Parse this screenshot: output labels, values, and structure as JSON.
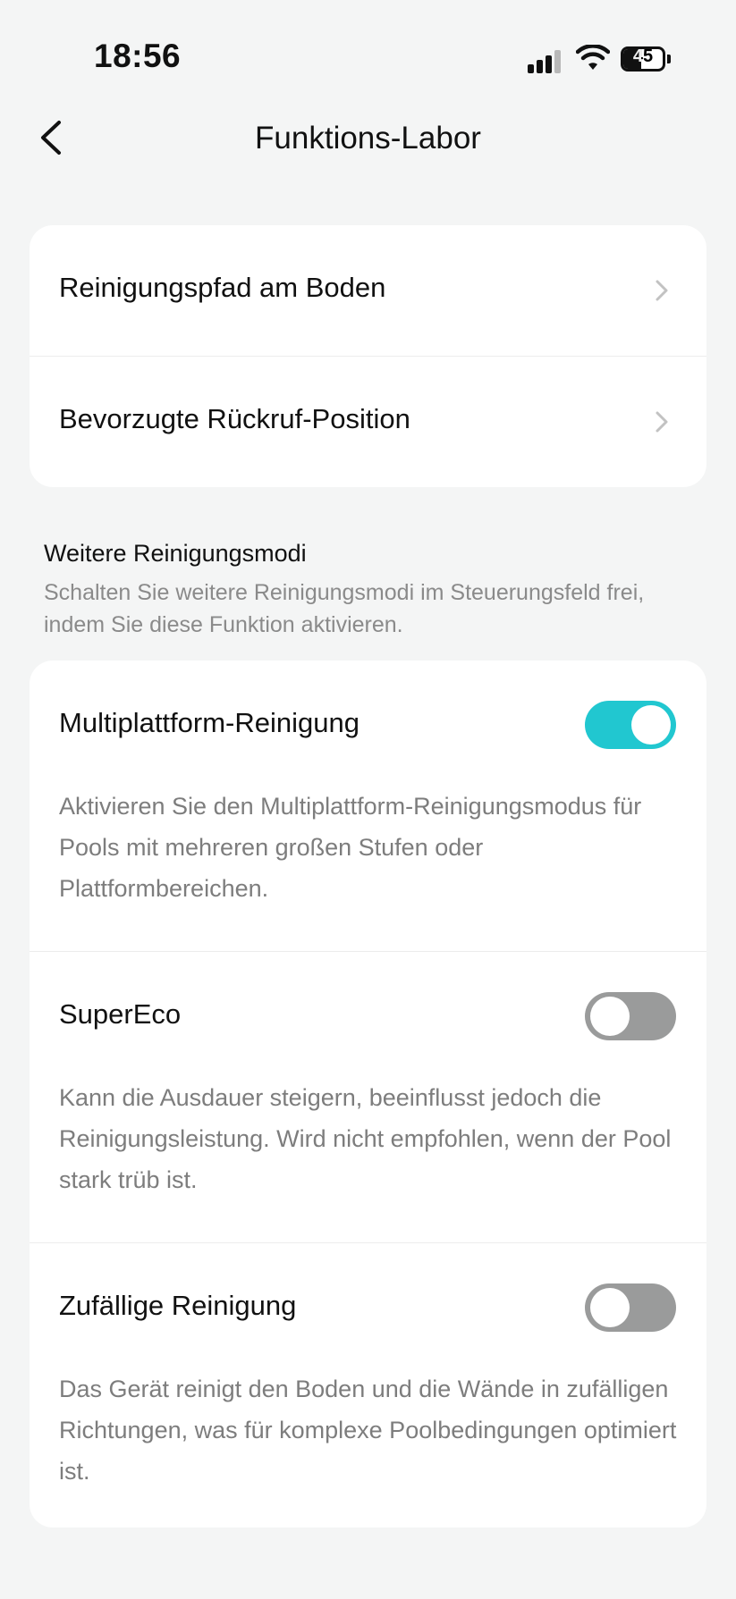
{
  "status_bar": {
    "time": "18:56",
    "battery_level": "45",
    "icons": [
      "signal-icon",
      "wifi-icon",
      "battery-icon"
    ]
  },
  "header": {
    "title": "Funktions-Labor",
    "back_icon": "chevron-left-icon"
  },
  "menu": {
    "items": [
      {
        "label": "Reinigungspfad am Boden",
        "icon": "chevron-right-icon"
      },
      {
        "label": "Bevorzugte Rückruf-Position",
        "icon": "chevron-right-icon"
      }
    ]
  },
  "modes_section": {
    "heading": "Weitere Reinigungsmodi",
    "description": "Schalten Sie weitere Reinigungsmodi im Steuerungsfeld frei, indem Sie diese Funktion aktivieren.",
    "toggles": [
      {
        "label": "Multiplattform-Reinigung",
        "enabled": true,
        "description": "Aktivieren Sie den Multiplattform-Reinigungsmodus für Pools mit mehreren großen Stufen oder Plattformbereichen."
      },
      {
        "label": "SuperEco",
        "enabled": false,
        "description": "Kann die Ausdauer steigern, beeinflusst jedoch die Reinigungsleistung. Wird nicht empfohlen, wenn der Pool stark trüb ist."
      },
      {
        "label": "Zufällige Reinigung",
        "enabled": false,
        "description": "Das Gerät reinigt den Boden und die Wände in zufälligen Richtungen, was für komplexe Poolbedingungen optimiert ist."
      }
    ]
  },
  "colors": {
    "accent": "#21c7d0",
    "toggle_off": "#9a9b9b",
    "background": "#f4f5f5",
    "card": "#ffffff"
  }
}
